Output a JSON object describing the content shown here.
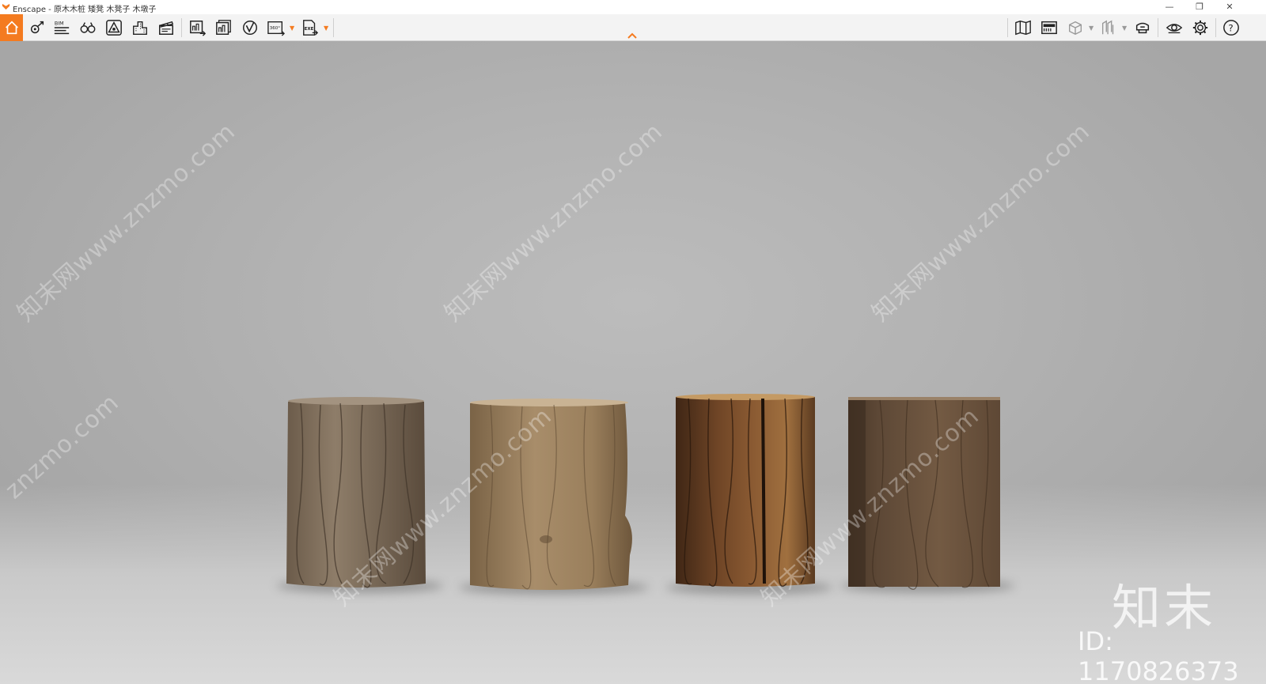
{
  "window": {
    "title": "Enscape - 原木木桩 矮凳 木凳子 木墩子",
    "minimize": "—",
    "restore": "❐",
    "close": "✕"
  },
  "toolbar": {
    "accent_color": "#f47b20",
    "left_tools": [
      {
        "name": "home-icon"
      },
      {
        "name": "view-management-icon"
      },
      {
        "name": "bim-icon",
        "label": "BIM"
      },
      {
        "name": "binoculars-icon"
      },
      {
        "name": "asset-library-icon"
      },
      {
        "name": "buildings-icon"
      },
      {
        "name": "clapperboard-icon"
      },
      {
        "name": "render-screenshot-icon"
      },
      {
        "name": "batch-render-icon"
      },
      {
        "name": "video-icon"
      },
      {
        "name": "panorama-icon",
        "label": "360°"
      },
      {
        "name": "export-exe-icon",
        "label": "EXE"
      }
    ],
    "right_tools": [
      {
        "name": "map-icon"
      },
      {
        "name": "material-editor-icon"
      },
      {
        "name": "cube-icon"
      },
      {
        "name": "section-icon"
      },
      {
        "name": "vr-headset-icon"
      },
      {
        "name": "eye-icon"
      },
      {
        "name": "settings-gear-icon"
      },
      {
        "name": "help-icon",
        "label": "?"
      }
    ]
  },
  "viewport": {
    "watermark_text": "知末网www.znzmo.com",
    "watermark_short": "znzmo.com",
    "logo": "知末",
    "id_label": "ID: 1170826373"
  }
}
